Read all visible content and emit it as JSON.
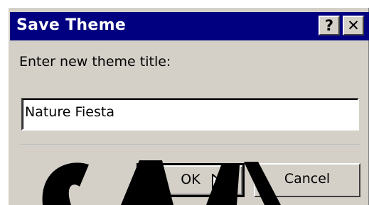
{
  "dialog": {
    "title": "Save Theme",
    "help_glyph": "?",
    "close_glyph": "✕",
    "prompt": "Enter new theme title:",
    "input_value": "Nature Fiesta",
    "ok_label": "OK",
    "cancel_label": "Cancel"
  },
  "icons": {
    "help": "help-icon",
    "close": "close-icon",
    "cursor": "mouse-pointer-icon"
  },
  "colors": {
    "titlebar": "#000080",
    "dialog_face": "#d4d0c8",
    "input_background": "#ffffff",
    "watermark": "#000000"
  }
}
